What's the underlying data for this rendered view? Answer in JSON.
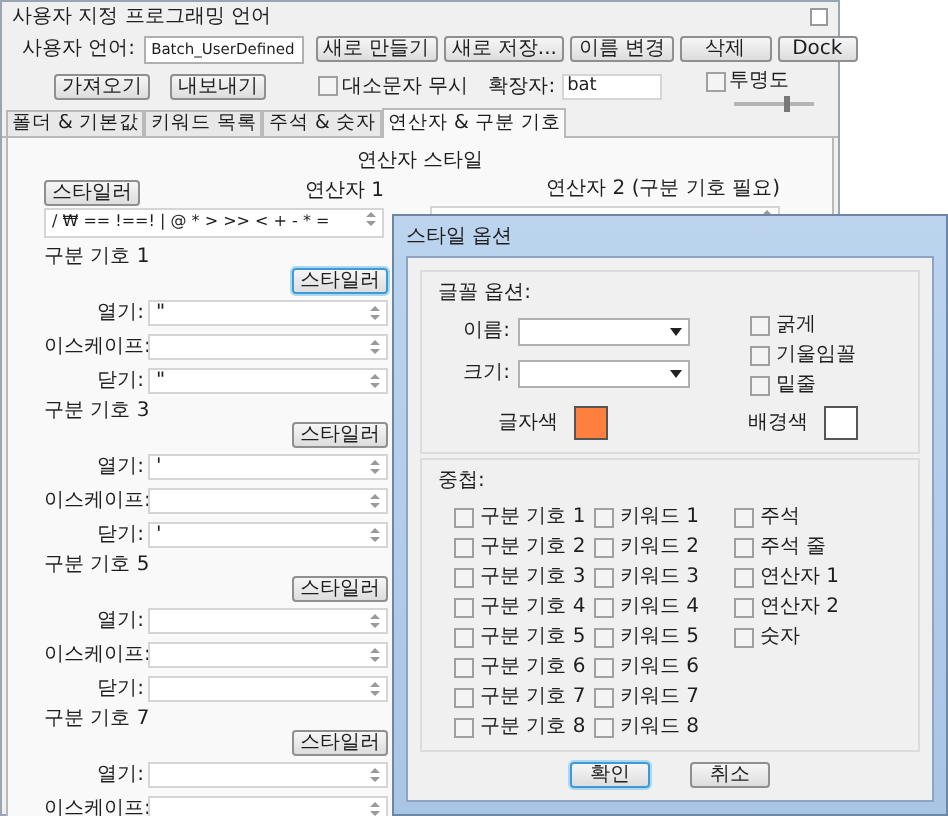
{
  "window": {
    "title": "사용자 지정 프로그래밍 언어"
  },
  "toolbar": {
    "language_label": "사용자 언어:",
    "language_value": "Batch_UserDefined",
    "buttons": [
      "새로 만들기",
      "새로 저장...",
      "이름 변경",
      "삭제",
      "Dock"
    ],
    "buttons_row2": [
      "가져오기",
      "내보내기"
    ],
    "ignore_case": {
      "label": "대소문자 무시",
      "checked": false
    },
    "extension": {
      "label": "확장자:",
      "value": "bat"
    },
    "transparency": {
      "label": "투명도",
      "checked": false,
      "level": 0.7
    }
  },
  "tabs": [
    {
      "label": "폴더 & 기본값",
      "selected": false
    },
    {
      "label": "키워드 목록",
      "selected": false
    },
    {
      "label": "주석 & 숫자",
      "selected": false
    },
    {
      "label": "연산자 & 구분 기호",
      "selected": true
    }
  ],
  "operator_style": {
    "title": "연산자 스타일",
    "styler_button": "스타일러",
    "operator1": {
      "label": "연산자 1",
      "value": "/ ₩ == !==! | @ * > >> < + - * ="
    },
    "operator2": {
      "label": "연산자 2 (구분 기호 필요)"
    }
  },
  "delimiters": [
    {
      "title": "구분 기호 1",
      "styler_button": "스타일러",
      "focused": true,
      "fields": [
        {
          "label": "열기:",
          "value": "\""
        },
        {
          "label": "이스케이프:"
        },
        {
          "label": "닫기:",
          "value": "\""
        }
      ]
    },
    {
      "title": "구분 기호 3",
      "styler_button": "스타일러",
      "focused": false,
      "fields": [
        {
          "label": "열기:",
          "value": "'"
        },
        {
          "label": "이스케이프:"
        },
        {
          "label": "닫기:",
          "value": "'"
        }
      ]
    },
    {
      "title": "구분 기호 5",
      "styler_button": "스타일러",
      "focused": false,
      "fields": [
        {
          "label": "열기:"
        },
        {
          "label": "이스케이프:"
        },
        {
          "label": "닫기:"
        }
      ]
    },
    {
      "title": "구분 기호 7",
      "styler_button": "스타일러",
      "focused": false,
      "fields": [
        {
          "label": "열기:"
        },
        {
          "label": "이스케이프:"
        }
      ]
    }
  ],
  "dialog": {
    "title": "스타일 옵션",
    "font_group": "글꼴 옵션:",
    "name_label": "이름:",
    "size_label": "크기:",
    "styles": [
      {
        "label": "굵게",
        "checked": false
      },
      {
        "label": "기울임꼴",
        "checked": false
      },
      {
        "label": "밑줄",
        "checked": false
      }
    ],
    "fg": {
      "label": "글자색",
      "color": "#ff7f3f"
    },
    "bg": {
      "label": "배경색",
      "color": "#ffffff"
    },
    "nesting_label": "중첩:",
    "nesting": [
      [
        {
          "label": "구분 기호 1",
          "checked": false
        },
        {
          "label": "구분 기호 2",
          "checked": false
        },
        {
          "label": "구분 기호 3",
          "checked": false
        },
        {
          "label": "구분 기호 4",
          "checked": false
        },
        {
          "label": "구분 기호 5",
          "checked": false
        },
        {
          "label": "구분 기호 6",
          "checked": false
        },
        {
          "label": "구분 기호 7",
          "checked": false
        },
        {
          "label": "구분 기호 8",
          "checked": false
        }
      ],
      [
        {
          "label": "키워드 1",
          "checked": false
        },
        {
          "label": "키워드 2",
          "checked": false
        },
        {
          "label": "키워드 3",
          "checked": false
        },
        {
          "label": "키워드 4",
          "checked": false
        },
        {
          "label": "키워드 5",
          "checked": false
        },
        {
          "label": "키워드 6",
          "checked": false
        },
        {
          "label": "키워드 7",
          "checked": false
        },
        {
          "label": "키워드 8",
          "checked": false
        }
      ],
      [
        {
          "label": "주석",
          "checked": false
        },
        {
          "label": "주석 줄",
          "checked": false
        },
        {
          "label": "연산자 1",
          "checked": false
        },
        {
          "label": "연산자 2",
          "checked": false
        },
        {
          "label": "숫자",
          "checked": false
        }
      ]
    ],
    "buttons": [
      {
        "label": "확인",
        "focused": true
      },
      {
        "label": "취소",
        "focused": false
      }
    ]
  }
}
